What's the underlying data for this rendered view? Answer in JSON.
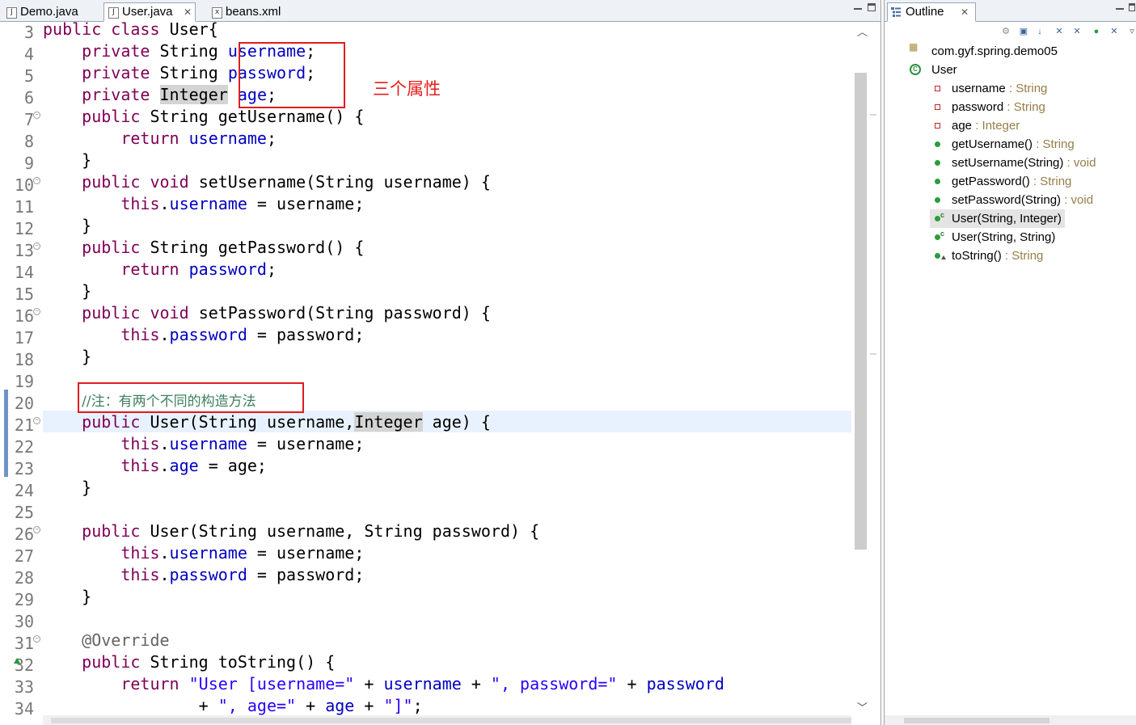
{
  "editor": {
    "tabs": [
      {
        "label": "Demo.java",
        "icon": "java-file-icon"
      },
      {
        "label": "User.java",
        "icon": "java-file-icon",
        "active": true
      },
      {
        "label": "beans.xml",
        "icon": "xml-file-icon"
      }
    ],
    "close_glyph": "✕",
    "line_numbers": [
      "3",
      "4",
      "5",
      "6",
      "7",
      "8",
      "9",
      "10",
      "11",
      "12",
      "13",
      "14",
      "15",
      "16",
      "17",
      "18",
      "19",
      "20",
      "21",
      "22",
      "23",
      "24",
      "25",
      "26",
      "27",
      "28",
      "29",
      "30",
      "31",
      "32",
      "33",
      "34"
    ],
    "code": {
      "l3": [
        "public",
        "class",
        "User{"
      ],
      "l4": [
        "private",
        "String",
        "username",
        ";"
      ],
      "l5": [
        "private",
        "String",
        "password",
        ";"
      ],
      "l6": [
        "private",
        "Integer",
        "age",
        ";"
      ],
      "l7": [
        "public",
        "String getUsername() {"
      ],
      "l8": [
        "return",
        "username",
        ";"
      ],
      "l9": "}",
      "l10": [
        "public",
        "void",
        "setUsername(String username) {"
      ],
      "l11": [
        "this",
        ".",
        "username",
        " = username;"
      ],
      "l12": "}",
      "l13": [
        "public",
        "String getPassword() {"
      ],
      "l14": [
        "return",
        "password",
        ";"
      ],
      "l15": "}",
      "l16": [
        "public",
        "void",
        "setPassword(String password) {"
      ],
      "l17": [
        "this",
        ".",
        "password",
        " = password;"
      ],
      "l18": "}",
      "l20": "//注：有两个不同的构造方法",
      "l21": [
        "public",
        "User(String username,",
        "Integer",
        " age) {"
      ],
      "l22": [
        "this",
        ".",
        "username",
        " = username;"
      ],
      "l23": [
        "this",
        ".",
        "age",
        " = age;"
      ],
      "l24": "}",
      "l26": [
        "public",
        "User(String username, String password) {"
      ],
      "l27": [
        "this",
        ".",
        "username",
        " = username;"
      ],
      "l28": [
        "this",
        ".",
        "password",
        " = password;"
      ],
      "l29": "}",
      "l31": "@Override",
      "l32": [
        "public",
        "String toString() {"
      ],
      "l33": [
        "return",
        "\"User [username=\"",
        " + ",
        "username",
        " + ",
        "\", password=\"",
        " + ",
        "password"
      ],
      "l34": [
        "+ ",
        "\", age=\"",
        " + ",
        "age",
        " + ",
        "\"]\"",
        ";"
      ]
    },
    "annotation_label": "三个属性"
  },
  "outline": {
    "tab_label": "Outline",
    "tree": {
      "package": "com.gyf.spring.demo05",
      "class": "User",
      "members": [
        {
          "name": "username",
          "type": " : String",
          "kind": "private-field"
        },
        {
          "name": "password",
          "type": " : String",
          "kind": "private-field"
        },
        {
          "name": "age",
          "type": " : Integer",
          "kind": "private-field"
        },
        {
          "name": "getUsername()",
          "type": " : String",
          "kind": "public-method"
        },
        {
          "name": "setUsername(String)",
          "type": " : void",
          "kind": "public-method"
        },
        {
          "name": "getPassword()",
          "type": " : String",
          "kind": "public-method"
        },
        {
          "name": "setPassword(String)",
          "type": " : void",
          "kind": "public-method"
        },
        {
          "name": "User(String, Integer)",
          "type": "",
          "kind": "constructor",
          "selected": true
        },
        {
          "name": "User(String, String)",
          "type": "",
          "kind": "constructor"
        },
        {
          "name": "toString()",
          "type": " : String",
          "kind": "override-method"
        }
      ]
    }
  },
  "colors": {
    "keyword": "#7f0055",
    "field": "#0000c0",
    "string": "#2a00ff",
    "comment": "#3f7f5f",
    "annotation_box": "#e01c1c",
    "current_line": "#e8f2fe"
  }
}
